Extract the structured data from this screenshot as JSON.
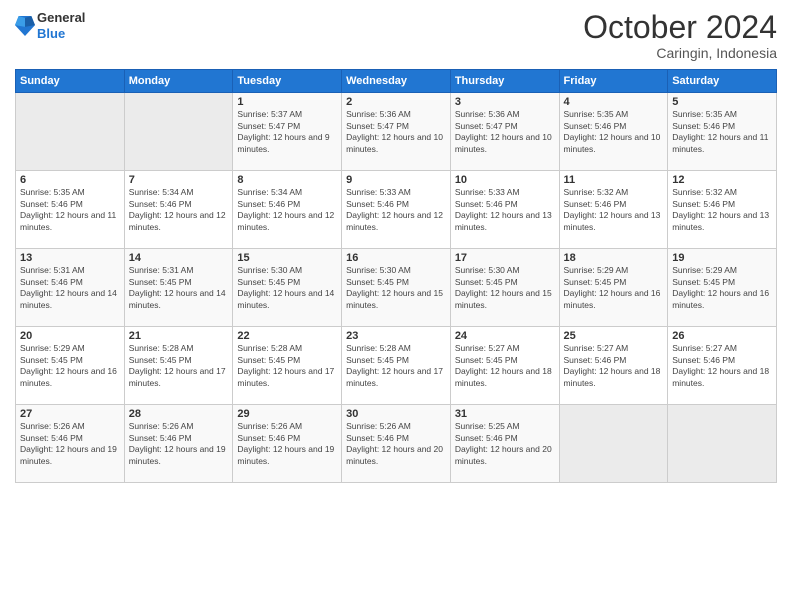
{
  "logo": {
    "general": "General",
    "blue": "Blue"
  },
  "header": {
    "month": "October 2024",
    "location": "Caringin, Indonesia"
  },
  "days_of_week": [
    "Sunday",
    "Monday",
    "Tuesday",
    "Wednesday",
    "Thursday",
    "Friday",
    "Saturday"
  ],
  "weeks": [
    [
      {
        "day": "",
        "sunrise": "",
        "sunset": "",
        "daylight": "",
        "empty": true
      },
      {
        "day": "",
        "sunrise": "",
        "sunset": "",
        "daylight": "",
        "empty": true
      },
      {
        "day": "1",
        "sunrise": "Sunrise: 5:37 AM",
        "sunset": "Sunset: 5:47 PM",
        "daylight": "Daylight: 12 hours and 9 minutes."
      },
      {
        "day": "2",
        "sunrise": "Sunrise: 5:36 AM",
        "sunset": "Sunset: 5:47 PM",
        "daylight": "Daylight: 12 hours and 10 minutes."
      },
      {
        "day": "3",
        "sunrise": "Sunrise: 5:36 AM",
        "sunset": "Sunset: 5:47 PM",
        "daylight": "Daylight: 12 hours and 10 minutes."
      },
      {
        "day": "4",
        "sunrise": "Sunrise: 5:35 AM",
        "sunset": "Sunset: 5:46 PM",
        "daylight": "Daylight: 12 hours and 10 minutes."
      },
      {
        "day": "5",
        "sunrise": "Sunrise: 5:35 AM",
        "sunset": "Sunset: 5:46 PM",
        "daylight": "Daylight: 12 hours and 11 minutes."
      }
    ],
    [
      {
        "day": "6",
        "sunrise": "Sunrise: 5:35 AM",
        "sunset": "Sunset: 5:46 PM",
        "daylight": "Daylight: 12 hours and 11 minutes."
      },
      {
        "day": "7",
        "sunrise": "Sunrise: 5:34 AM",
        "sunset": "Sunset: 5:46 PM",
        "daylight": "Daylight: 12 hours and 12 minutes."
      },
      {
        "day": "8",
        "sunrise": "Sunrise: 5:34 AM",
        "sunset": "Sunset: 5:46 PM",
        "daylight": "Daylight: 12 hours and 12 minutes."
      },
      {
        "day": "9",
        "sunrise": "Sunrise: 5:33 AM",
        "sunset": "Sunset: 5:46 PM",
        "daylight": "Daylight: 12 hours and 12 minutes."
      },
      {
        "day": "10",
        "sunrise": "Sunrise: 5:33 AM",
        "sunset": "Sunset: 5:46 PM",
        "daylight": "Daylight: 12 hours and 13 minutes."
      },
      {
        "day": "11",
        "sunrise": "Sunrise: 5:32 AM",
        "sunset": "Sunset: 5:46 PM",
        "daylight": "Daylight: 12 hours and 13 minutes."
      },
      {
        "day": "12",
        "sunrise": "Sunrise: 5:32 AM",
        "sunset": "Sunset: 5:46 PM",
        "daylight": "Daylight: 12 hours and 13 minutes."
      }
    ],
    [
      {
        "day": "13",
        "sunrise": "Sunrise: 5:31 AM",
        "sunset": "Sunset: 5:46 PM",
        "daylight": "Daylight: 12 hours and 14 minutes."
      },
      {
        "day": "14",
        "sunrise": "Sunrise: 5:31 AM",
        "sunset": "Sunset: 5:45 PM",
        "daylight": "Daylight: 12 hours and 14 minutes."
      },
      {
        "day": "15",
        "sunrise": "Sunrise: 5:30 AM",
        "sunset": "Sunset: 5:45 PM",
        "daylight": "Daylight: 12 hours and 14 minutes."
      },
      {
        "day": "16",
        "sunrise": "Sunrise: 5:30 AM",
        "sunset": "Sunset: 5:45 PM",
        "daylight": "Daylight: 12 hours and 15 minutes."
      },
      {
        "day": "17",
        "sunrise": "Sunrise: 5:30 AM",
        "sunset": "Sunset: 5:45 PM",
        "daylight": "Daylight: 12 hours and 15 minutes."
      },
      {
        "day": "18",
        "sunrise": "Sunrise: 5:29 AM",
        "sunset": "Sunset: 5:45 PM",
        "daylight": "Daylight: 12 hours and 16 minutes."
      },
      {
        "day": "19",
        "sunrise": "Sunrise: 5:29 AM",
        "sunset": "Sunset: 5:45 PM",
        "daylight": "Daylight: 12 hours and 16 minutes."
      }
    ],
    [
      {
        "day": "20",
        "sunrise": "Sunrise: 5:29 AM",
        "sunset": "Sunset: 5:45 PM",
        "daylight": "Daylight: 12 hours and 16 minutes."
      },
      {
        "day": "21",
        "sunrise": "Sunrise: 5:28 AM",
        "sunset": "Sunset: 5:45 PM",
        "daylight": "Daylight: 12 hours and 17 minutes."
      },
      {
        "day": "22",
        "sunrise": "Sunrise: 5:28 AM",
        "sunset": "Sunset: 5:45 PM",
        "daylight": "Daylight: 12 hours and 17 minutes."
      },
      {
        "day": "23",
        "sunrise": "Sunrise: 5:28 AM",
        "sunset": "Sunset: 5:45 PM",
        "daylight": "Daylight: 12 hours and 17 minutes."
      },
      {
        "day": "24",
        "sunrise": "Sunrise: 5:27 AM",
        "sunset": "Sunset: 5:45 PM",
        "daylight": "Daylight: 12 hours and 18 minutes."
      },
      {
        "day": "25",
        "sunrise": "Sunrise: 5:27 AM",
        "sunset": "Sunset: 5:46 PM",
        "daylight": "Daylight: 12 hours and 18 minutes."
      },
      {
        "day": "26",
        "sunrise": "Sunrise: 5:27 AM",
        "sunset": "Sunset: 5:46 PM",
        "daylight": "Daylight: 12 hours and 18 minutes."
      }
    ],
    [
      {
        "day": "27",
        "sunrise": "Sunrise: 5:26 AM",
        "sunset": "Sunset: 5:46 PM",
        "daylight": "Daylight: 12 hours and 19 minutes."
      },
      {
        "day": "28",
        "sunrise": "Sunrise: 5:26 AM",
        "sunset": "Sunset: 5:46 PM",
        "daylight": "Daylight: 12 hours and 19 minutes."
      },
      {
        "day": "29",
        "sunrise": "Sunrise: 5:26 AM",
        "sunset": "Sunset: 5:46 PM",
        "daylight": "Daylight: 12 hours and 19 minutes."
      },
      {
        "day": "30",
        "sunrise": "Sunrise: 5:26 AM",
        "sunset": "Sunset: 5:46 PM",
        "daylight": "Daylight: 12 hours and 20 minutes."
      },
      {
        "day": "31",
        "sunrise": "Sunrise: 5:25 AM",
        "sunset": "Sunset: 5:46 PM",
        "daylight": "Daylight: 12 hours and 20 minutes."
      },
      {
        "day": "",
        "sunrise": "",
        "sunset": "",
        "daylight": "",
        "empty": true
      },
      {
        "day": "",
        "sunrise": "",
        "sunset": "",
        "daylight": "",
        "empty": true
      }
    ]
  ]
}
